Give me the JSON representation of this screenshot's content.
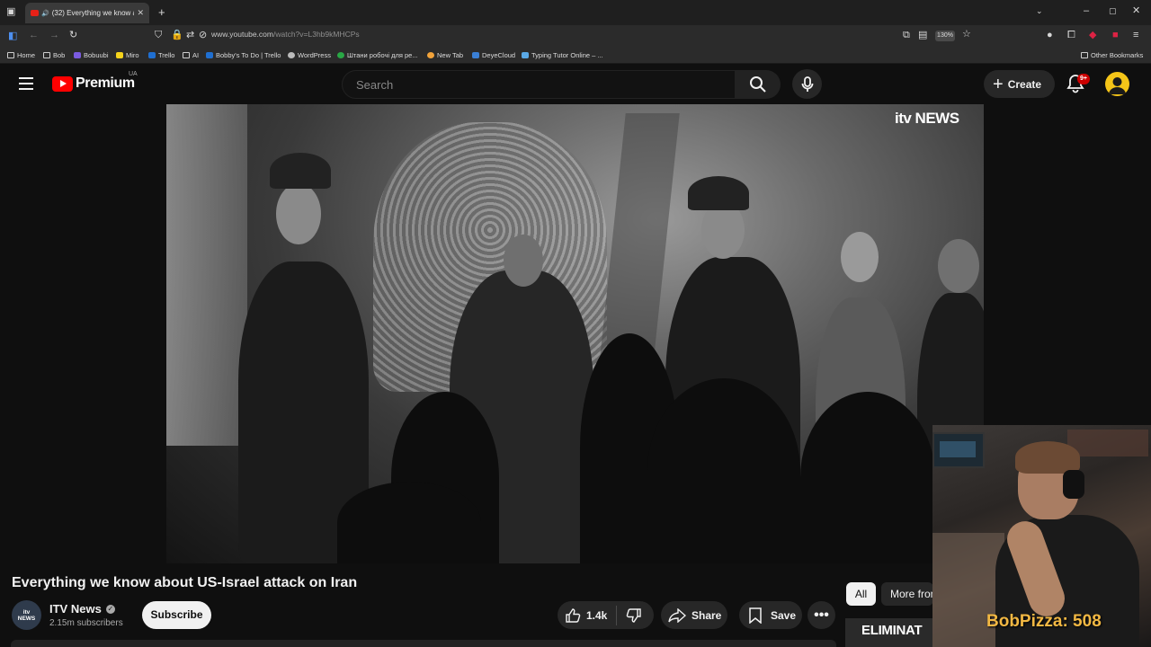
{
  "browser": {
    "tab_title": "(32) Everything we know al",
    "url_domain": "www.youtube.com",
    "url_path": "/watch?v=L3hb9kMHCPs",
    "zoom": "130%",
    "bookmarks": [
      {
        "label": "Home"
      },
      {
        "label": "Bob"
      },
      {
        "label": "Bobuubi"
      },
      {
        "label": "Miro"
      },
      {
        "label": "Trello"
      },
      {
        "label": "AI"
      },
      {
        "label": "Bobby's To Do | Trello"
      },
      {
        "label": "WordPress"
      },
      {
        "label": "Штани робочі для ре..."
      },
      {
        "label": "New Tab"
      },
      {
        "label": "DeyeCloud"
      },
      {
        "label": "Typing Tutor Online – ..."
      }
    ],
    "other_bookmarks": "Other Bookmarks"
  },
  "header": {
    "logo_text": "Premium",
    "country_code": "UA",
    "search_placeholder": "Search",
    "create_label": "Create",
    "notification_count": "9+"
  },
  "player": {
    "watermark": "itv NEWS"
  },
  "video": {
    "title": "Everything we know about US-Israel attack on Iran",
    "channel_avatar_text_1": "itv",
    "channel_avatar_text_2": "NEWS",
    "channel_name": "ITV News",
    "subscribers": "2.15m subscribers",
    "subscribe_label": "Subscribe",
    "likes": "1.4k",
    "share_label": "Share",
    "save_label": "Save"
  },
  "sidebar": {
    "chips": [
      {
        "label": "All",
        "active": true
      },
      {
        "label": "More from"
      }
    ],
    "thumb_text": "ELIMINAT"
  },
  "overlay": {
    "points_text": "BobPizza: 508"
  },
  "colors": {
    "background": "#0f0f0f",
    "youtube_red": "#ff0000",
    "badge_red": "#cc0000",
    "points_gold": "#f2b843"
  }
}
